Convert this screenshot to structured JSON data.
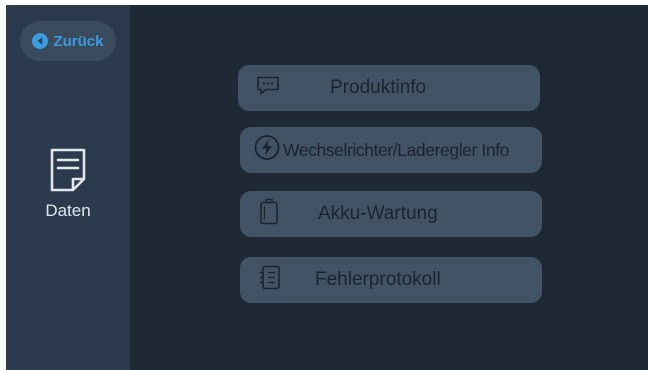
{
  "sidebar": {
    "back": {
      "label": "Zurück",
      "icon": "back-arrow-icon"
    },
    "section": {
      "label": "Daten",
      "icon": "document-icon"
    }
  },
  "menu": [
    {
      "label": "Produktinfo",
      "icon": "message-dots-icon"
    },
    {
      "label": "Wechselrichter/Laderegler Info",
      "icon": "lightning-icon"
    },
    {
      "label": "Akku-Wartung",
      "icon": "battery-icon"
    },
    {
      "label": "Fehlerprotokoll",
      "icon": "notebook-icon"
    }
  ],
  "colors": {
    "background": "#1f2835",
    "sidebar": "#2b3b4d",
    "button": "#425366",
    "accent": "#3d9be0",
    "button_text": "#1c2431"
  }
}
